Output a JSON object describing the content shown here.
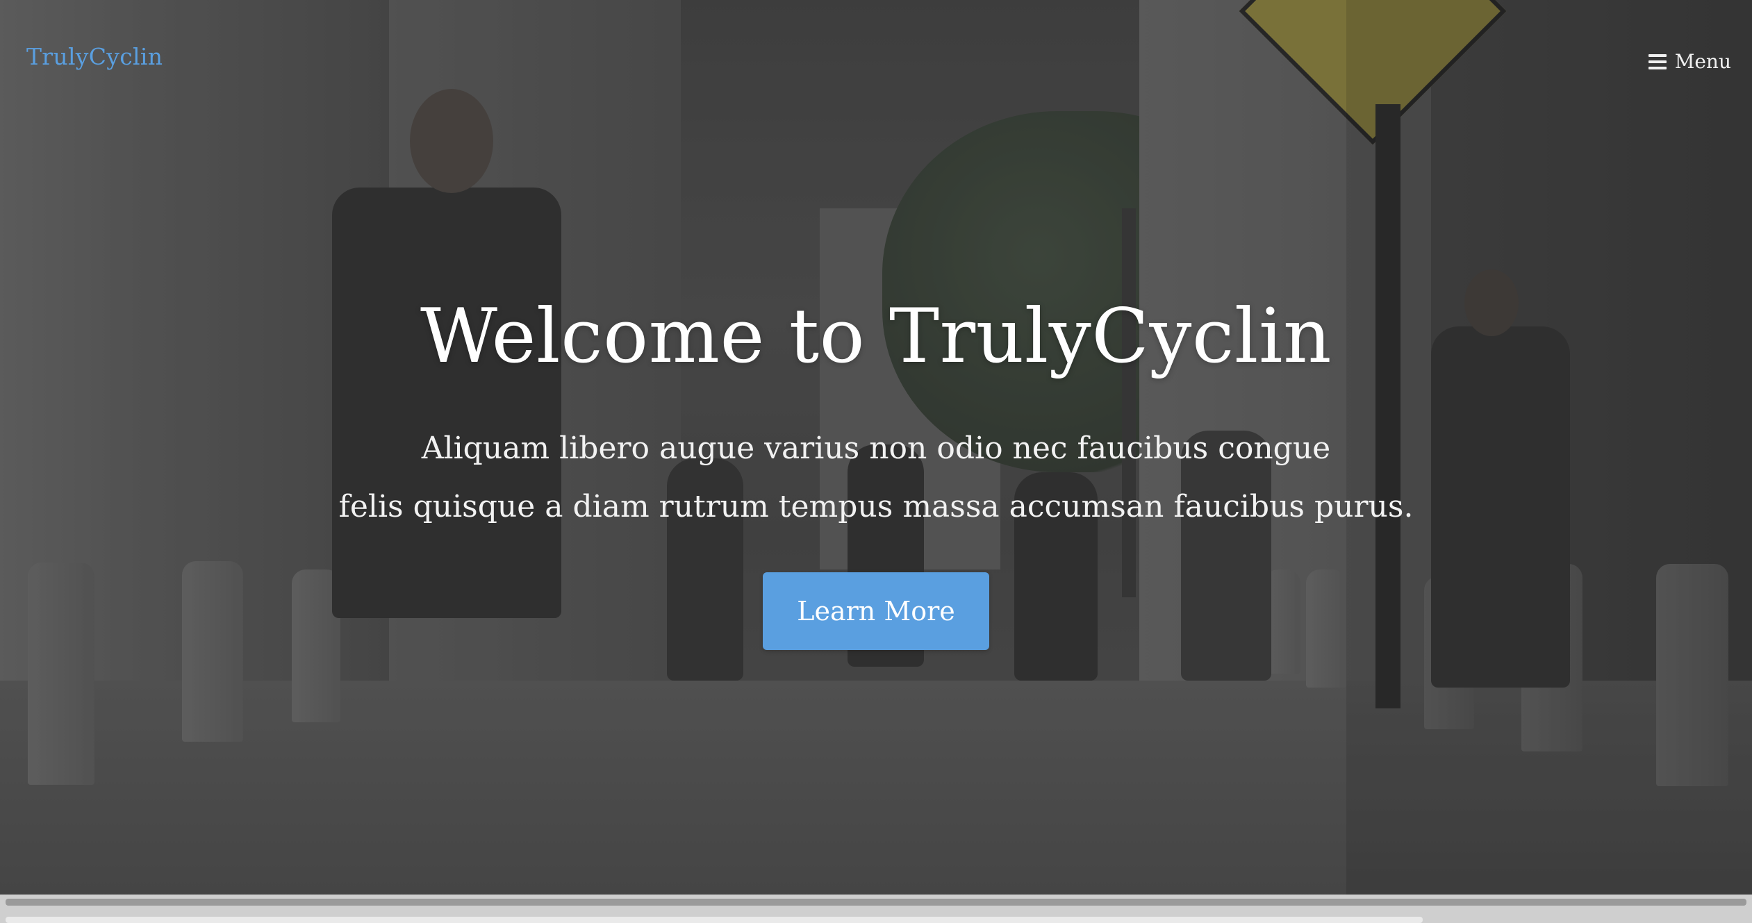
{
  "navbar": {
    "brand": "TrulyCyclin",
    "menu_label": "Menu",
    "menu_icon": "hamburger-icon"
  },
  "hero": {
    "title": "Welcome to TrulyCyclin",
    "subtitle_line1": "Aliquam libero augue varius non odio nec faucibus congue",
    "subtitle_line2": "felis quisque a diam rutrum tempus massa accumsan faucibus purus.",
    "cta_label": "Learn More",
    "background": "street-crowd-photo"
  },
  "colors": {
    "accent": "#5a9fe0",
    "overlay": "#141414",
    "text": "#ffffff"
  }
}
